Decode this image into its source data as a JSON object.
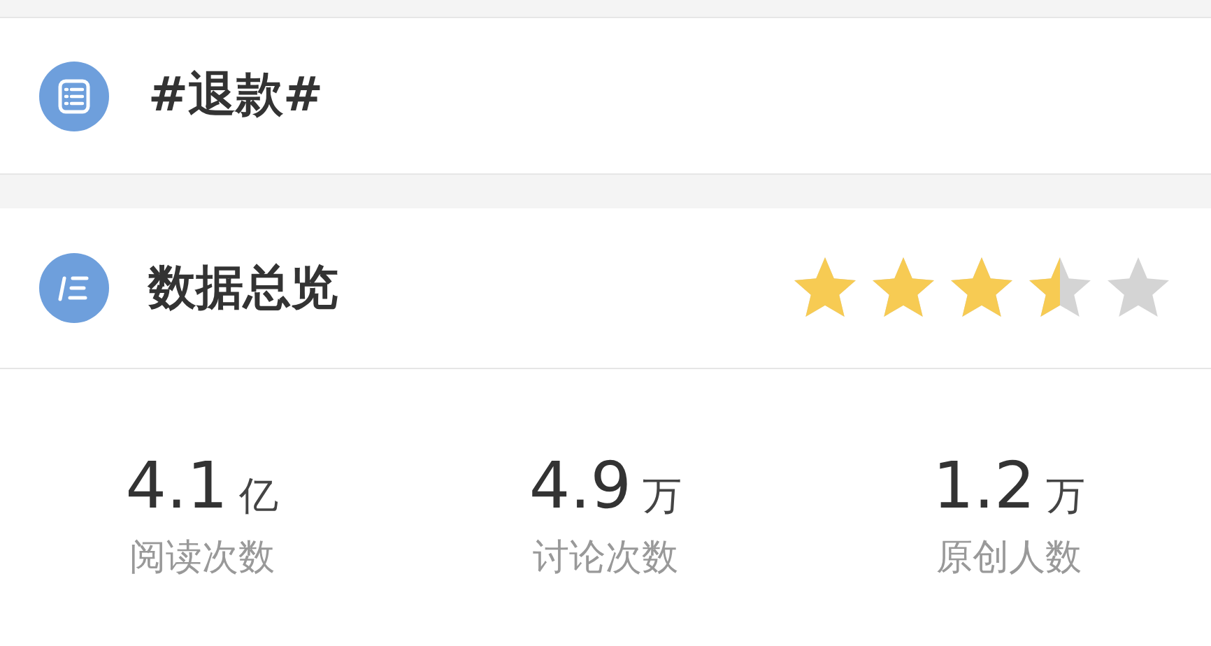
{
  "topic": {
    "title": "#退款#"
  },
  "overview": {
    "title": "数据总览",
    "stars": 3.5
  },
  "stats": [
    {
      "value": "4.1",
      "unit": "亿",
      "label": "阅读次数"
    },
    {
      "value": "4.9",
      "unit": "万",
      "label": "讨论次数"
    },
    {
      "value": "1.2",
      "unit": "万",
      "label": "原创人数"
    }
  ]
}
